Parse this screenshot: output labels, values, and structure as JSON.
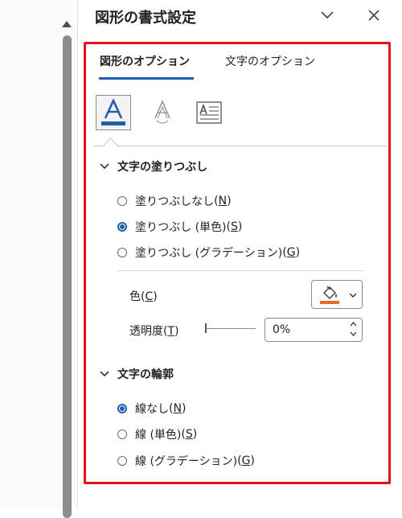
{
  "pane": {
    "title": "図形の書式設定",
    "dropdown_icon": "chevron-down-icon",
    "close_icon": "close-icon"
  },
  "tabs": [
    {
      "label": "図形のオプション",
      "active": true
    },
    {
      "label": "文字のオプション",
      "active": false
    }
  ],
  "icon_buttons": [
    {
      "name": "text-fill-outline-icon",
      "selected": true
    },
    {
      "name": "text-effects-icon",
      "selected": false
    },
    {
      "name": "textbox-icon",
      "selected": false
    }
  ],
  "fill_section": {
    "title": "文字の塗りつぶし",
    "options": [
      {
        "label": "塗りつぶしなし",
        "key": "N",
        "checked": false
      },
      {
        "label": "塗りつぶし (単色)",
        "key": "S",
        "checked": true
      },
      {
        "label": "塗りつぶし (グラデーション)",
        "key": "G",
        "checked": false
      }
    ],
    "color_label": "色",
    "color_key": "C",
    "color_value": "#e96b2b",
    "transparency_label": "透明度",
    "transparency_key": "T",
    "transparency_value": "0%"
  },
  "outline_section": {
    "title": "文字の輪郭",
    "options": [
      {
        "label": "線なし",
        "key": "N",
        "checked": true
      },
      {
        "label": "線 (単色)",
        "key": "S",
        "checked": false
      },
      {
        "label": "線 (グラデーション)",
        "key": "G",
        "checked": false
      }
    ]
  },
  "colors": {
    "accent": "#1f5fad",
    "highlight_frame": "#e0141e"
  }
}
